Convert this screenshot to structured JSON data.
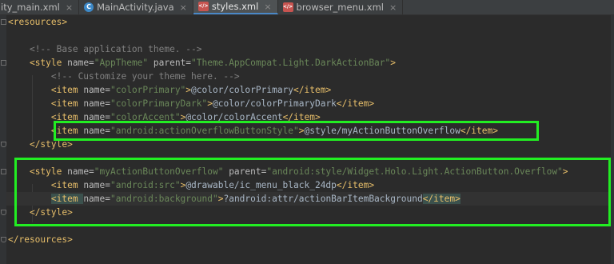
{
  "tabs": [
    {
      "label": "ity_main.xml",
      "icon": "xml-file-icon",
      "active": false,
      "closable": true
    },
    {
      "label": "MainActivity.java",
      "icon": "java-class-icon",
      "active": false,
      "closable": true
    },
    {
      "label": "styles.xml",
      "icon": "xml-file-icon",
      "active": true,
      "closable": true
    },
    {
      "label": "browser_menu.xml",
      "icon": "xml-menu-file-icon",
      "active": false,
      "closable": true
    }
  ],
  "tab_close_glyph": "×",
  "code": {
    "l1": {
      "open": "<resources>"
    },
    "l2": {},
    "l3": {
      "comment": "<!-- Base application theme. -->"
    },
    "l4": {
      "open": "<style ",
      "a1": "name=",
      "v1": "\"AppTheme\"",
      "a2": " parent=",
      "v2": "\"Theme.AppCompat.Light.DarkActionBar\"",
      "close": ">"
    },
    "l5": {
      "comment": "<!-- Customize your theme here. -->"
    },
    "l6": {
      "open": "<item ",
      "a1": "name=",
      "v1": "\"colorPrimary\"",
      "gt": ">",
      "text": "@color/colorPrimary",
      "close": "</item>"
    },
    "l7": {
      "open": "<item ",
      "a1": "name=",
      "v1": "\"colorPrimaryDark\"",
      "gt": ">",
      "text": "@color/colorPrimaryDark",
      "close": "</item>"
    },
    "l8": {
      "open": "<item ",
      "a1": "name=",
      "v1": "\"colorAccent\"",
      "gt": ">",
      "text": "@color/colorAccent",
      "close": "</item>"
    },
    "l9": {
      "open": "<item ",
      "a1": "name=",
      "v1": "\"android:actionOverflowButtonStyle\"",
      "gt": ">",
      "text": "@style/myActionButtonOverflow",
      "close": "</item>"
    },
    "l10": {
      "close": "</style>"
    },
    "l11": {},
    "l12": {
      "open": "<style ",
      "a1": "name=",
      "v1": "\"myActionButtonOverflow\"",
      "a2": " parent=",
      "v2": "\"android:style/Widget.Holo.Light.ActionButton.Overflow\"",
      "close": ">"
    },
    "l13": {
      "open": "<item ",
      "a1": "name=",
      "v1": "\"android:src\"",
      "gt": ">",
      "text": "@drawable/ic_menu_black_24dp",
      "close": "</item>"
    },
    "l14": {
      "open": "<item ",
      "a1": "name=",
      "v1": "\"android:background\"",
      "gt": ">",
      "text": "?android:attr/actionBarItemBackground",
      "close": "</item>"
    },
    "l15": {
      "close": "</style>"
    },
    "l16": {},
    "l17": {
      "close": "</resources>"
    }
  },
  "highlight_color": "#22ee22"
}
